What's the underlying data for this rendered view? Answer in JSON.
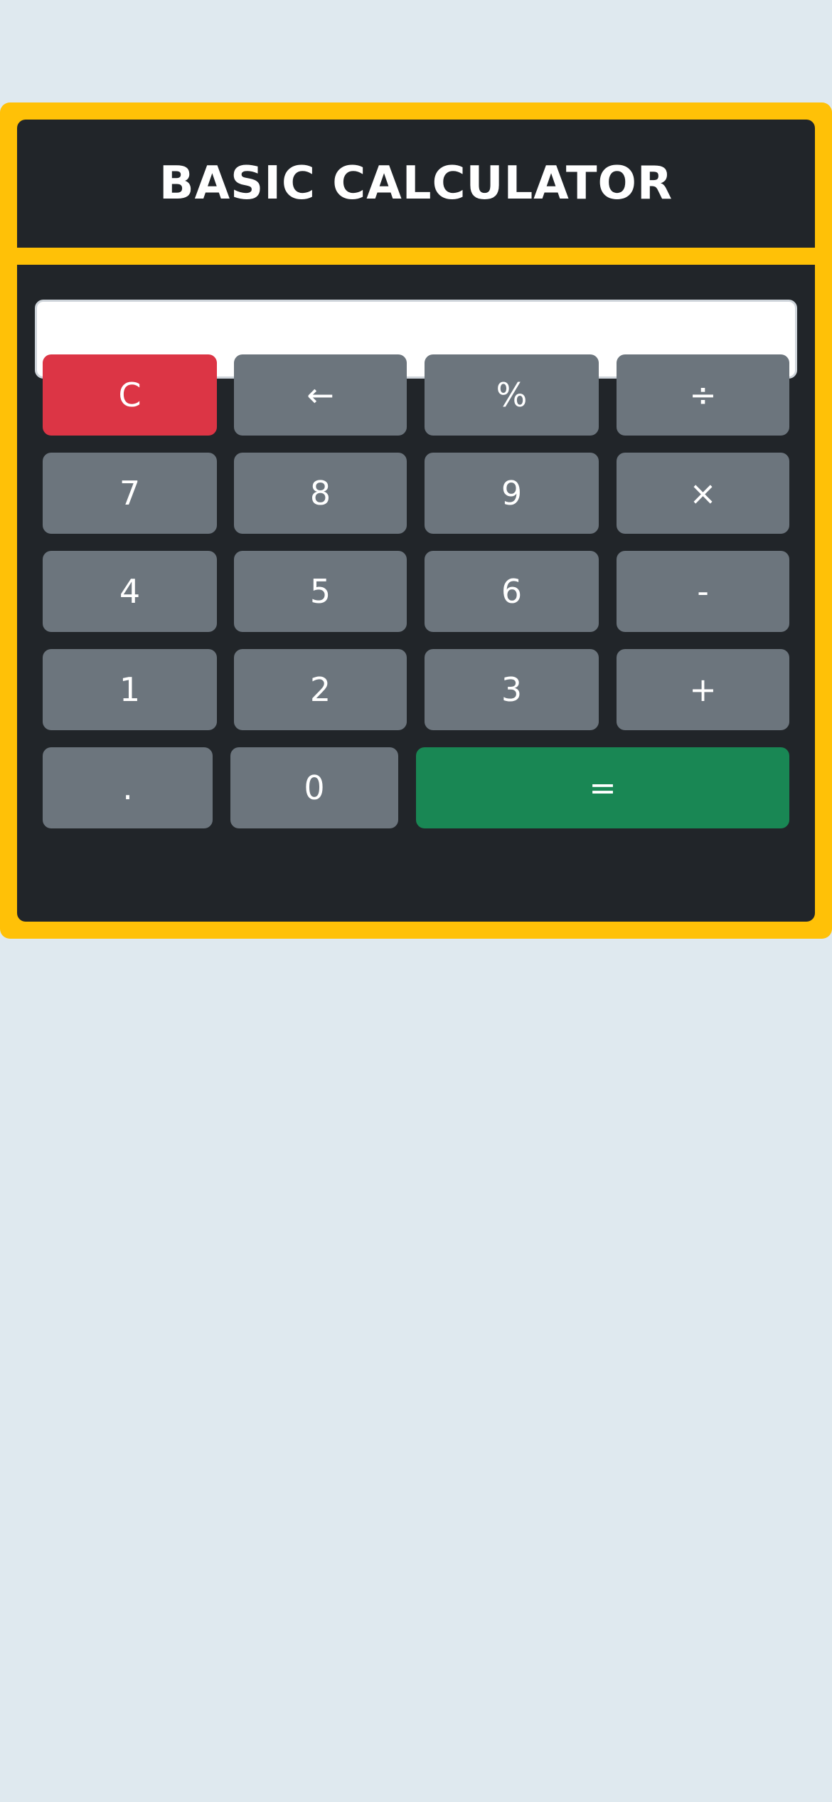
{
  "app": {
    "title": "BASIC CALCULATOR"
  },
  "display": {
    "value": "",
    "placeholder": ""
  },
  "colors": {
    "background": "#dfe9ef",
    "frame": "#ffc107",
    "panel": "#212529",
    "key": "#6c757d",
    "clear_key": "#dc3545",
    "equals_key": "#198754"
  },
  "keys": {
    "clear": "C",
    "backspace": "←",
    "percent": "%",
    "divide": "÷",
    "seven": "7",
    "eight": "8",
    "nine": "9",
    "multiply": "×",
    "four": "4",
    "five": "5",
    "six": "6",
    "subtract": "-",
    "one": "1",
    "two": "2",
    "three": "3",
    "add": "+",
    "decimal": ".",
    "zero": "0",
    "equals": "="
  }
}
